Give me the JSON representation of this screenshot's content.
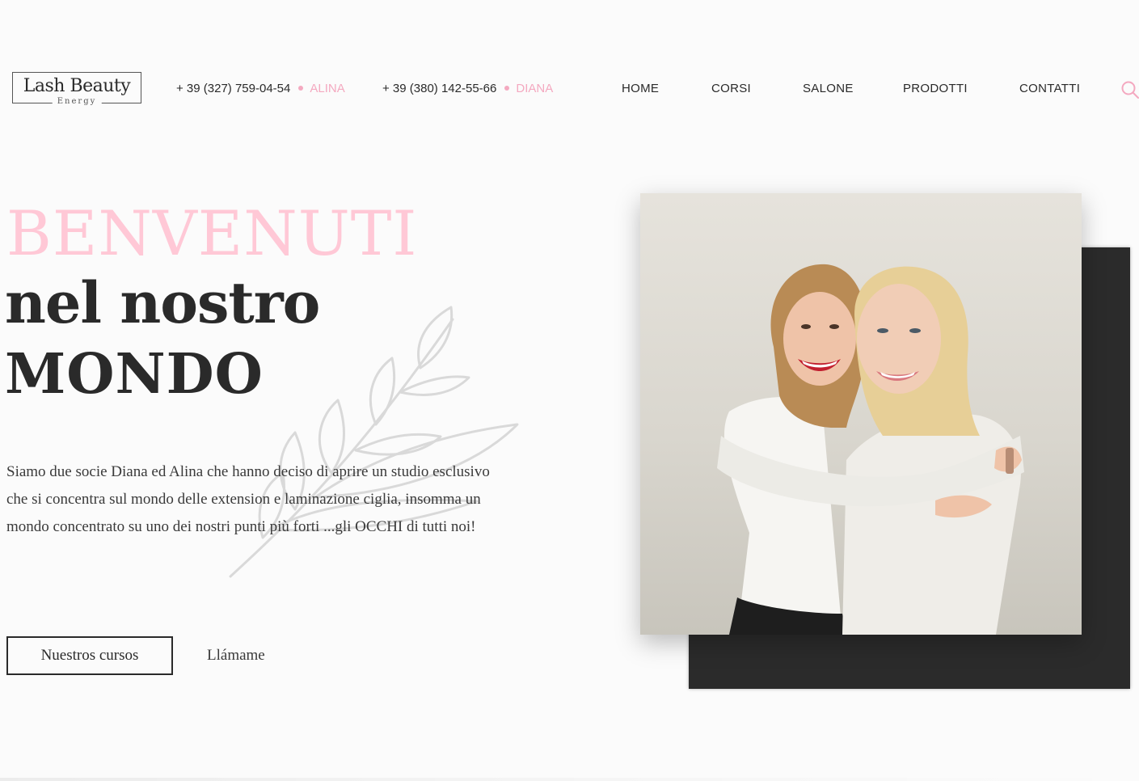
{
  "header": {
    "logo": {
      "title": "Lash Beauty",
      "subtitle": "Energy"
    },
    "contacts": [
      {
        "phone": "+ 39 (327) 759-04-54",
        "name": "ALINA"
      },
      {
        "phone": "+ 39 (380) 142-55-66",
        "name": "DIANA"
      }
    ],
    "nav": {
      "home": "HOME",
      "corsi": "CORSI",
      "salone": "SALONE",
      "prodotti": "PRODOTTI",
      "contatti": "CONTATTI"
    },
    "search_icon": "search-icon"
  },
  "hero": {
    "line1": "BENVENUTI",
    "line2": "nel nostro",
    "line3": "MONDO",
    "intro": "Siamo due socie Diana ed Alina che hanno deciso di aprire un studio esclusivo che si concentra sul mondo delle extension e laminazione ciglia, insomma un mondo concentrato su uno dei nostri punti più forti ...gli OCCHI di tutti noi!",
    "primary_button": "Nuestros cursos",
    "secondary_link": "Llámame"
  },
  "colors": {
    "accent_pink": "#f4a9c0",
    "title_pink": "#ffc8d6",
    "dark": "#2a2a2a",
    "background": "#fbfbfb"
  },
  "icons": [
    "search-icon",
    "leaf-branch-decoration"
  ]
}
